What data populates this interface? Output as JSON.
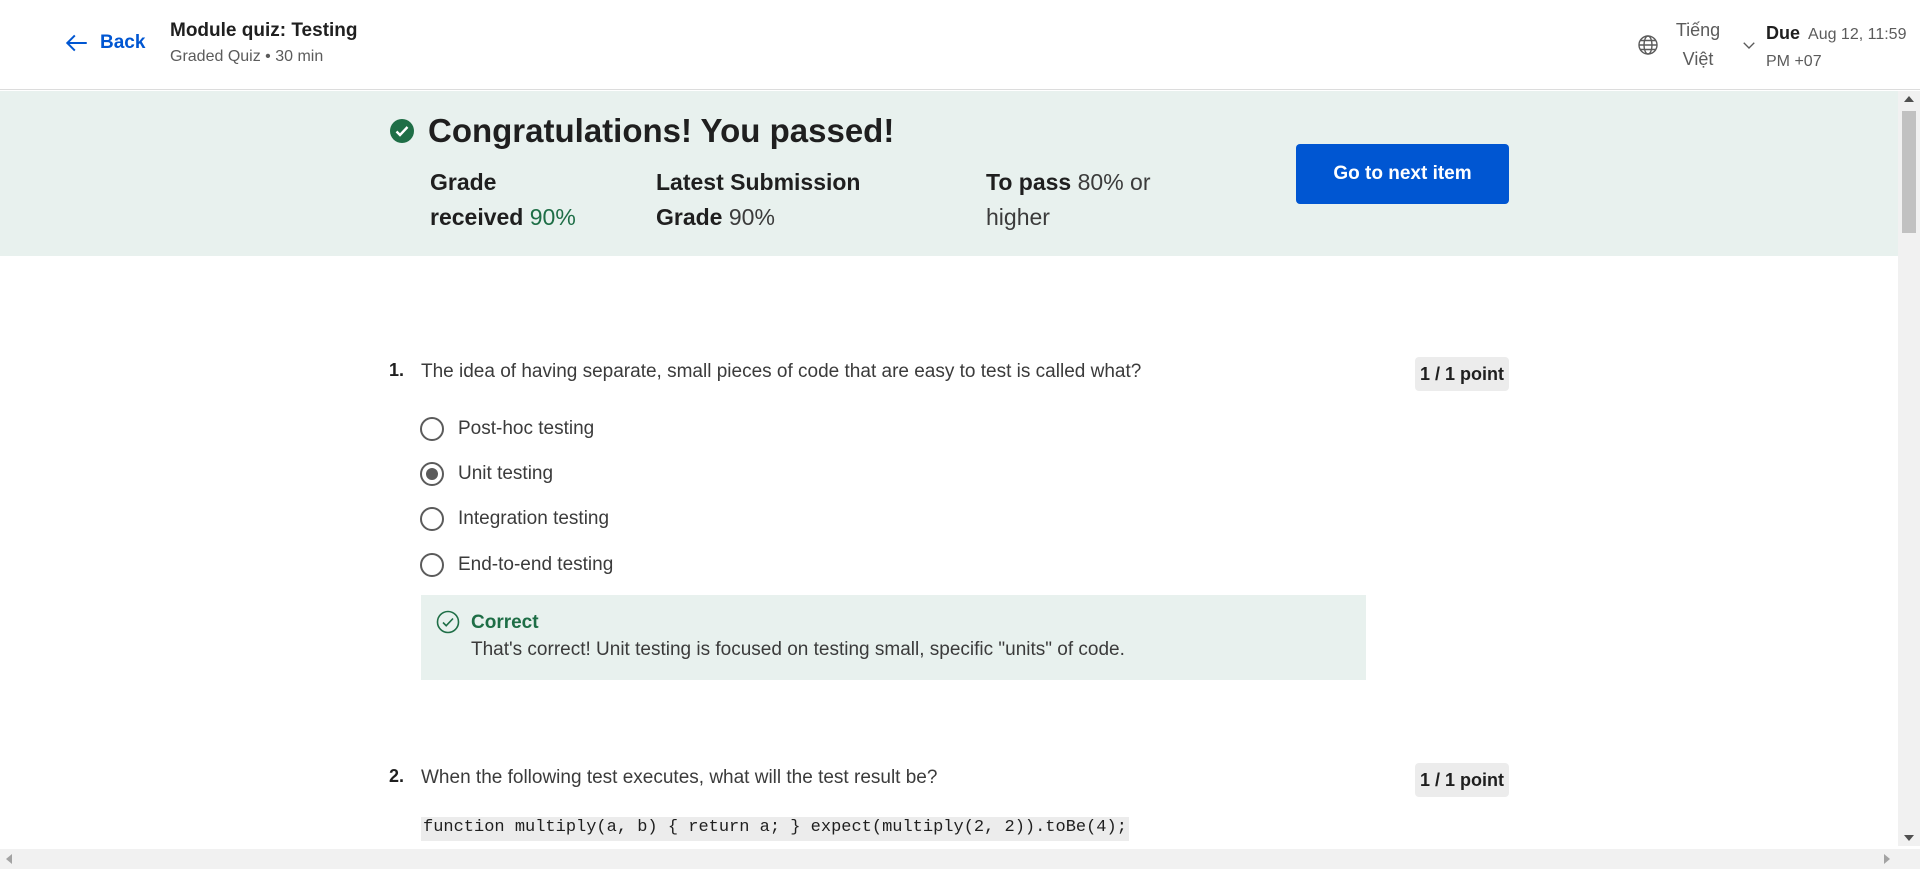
{
  "header": {
    "back_label": "Back",
    "title": "Module quiz: Testing",
    "subtitle": "Graded Quiz • 30 min",
    "language_line1": "Tiếng",
    "language_line2": "Việt",
    "due_label": "Due",
    "due_line1": "Aug 12, 11:59",
    "due_line2": "PM +07"
  },
  "banner": {
    "heading": "Congratulations! You passed!",
    "grade_label_1": "Grade",
    "grade_label_2": "received",
    "grade_value": "90%",
    "latest_label_1": "Latest Submission",
    "latest_label_2": "Grade",
    "latest_value": "90%",
    "pass_label": "To pass",
    "pass_value": "80% or",
    "pass_value_2": "higher",
    "next_button": "Go to next item",
    "accent_color": "#0056d2",
    "success_color": "#1e6e46"
  },
  "questions": [
    {
      "number": "1.",
      "text": "The idea of having separate, small pieces of code that are easy to test is called what?",
      "points": "1 / 1 point",
      "options": [
        {
          "label": "Post-hoc testing",
          "selected": false
        },
        {
          "label": "Unit testing",
          "selected": true
        },
        {
          "label": "Integration testing",
          "selected": false
        },
        {
          "label": "End-to-end testing",
          "selected": false
        }
      ],
      "feedback_title": "Correct",
      "feedback_text": "That's correct! Unit testing is focused on testing small, specific \"units\" of code."
    },
    {
      "number": "2.",
      "text": "When the following test executes, what will the test result be?",
      "points": "1 / 1 point",
      "code": "function multiply(a, b) { return a; } expect(multiply(2, 2)).toBe(4);"
    }
  ]
}
